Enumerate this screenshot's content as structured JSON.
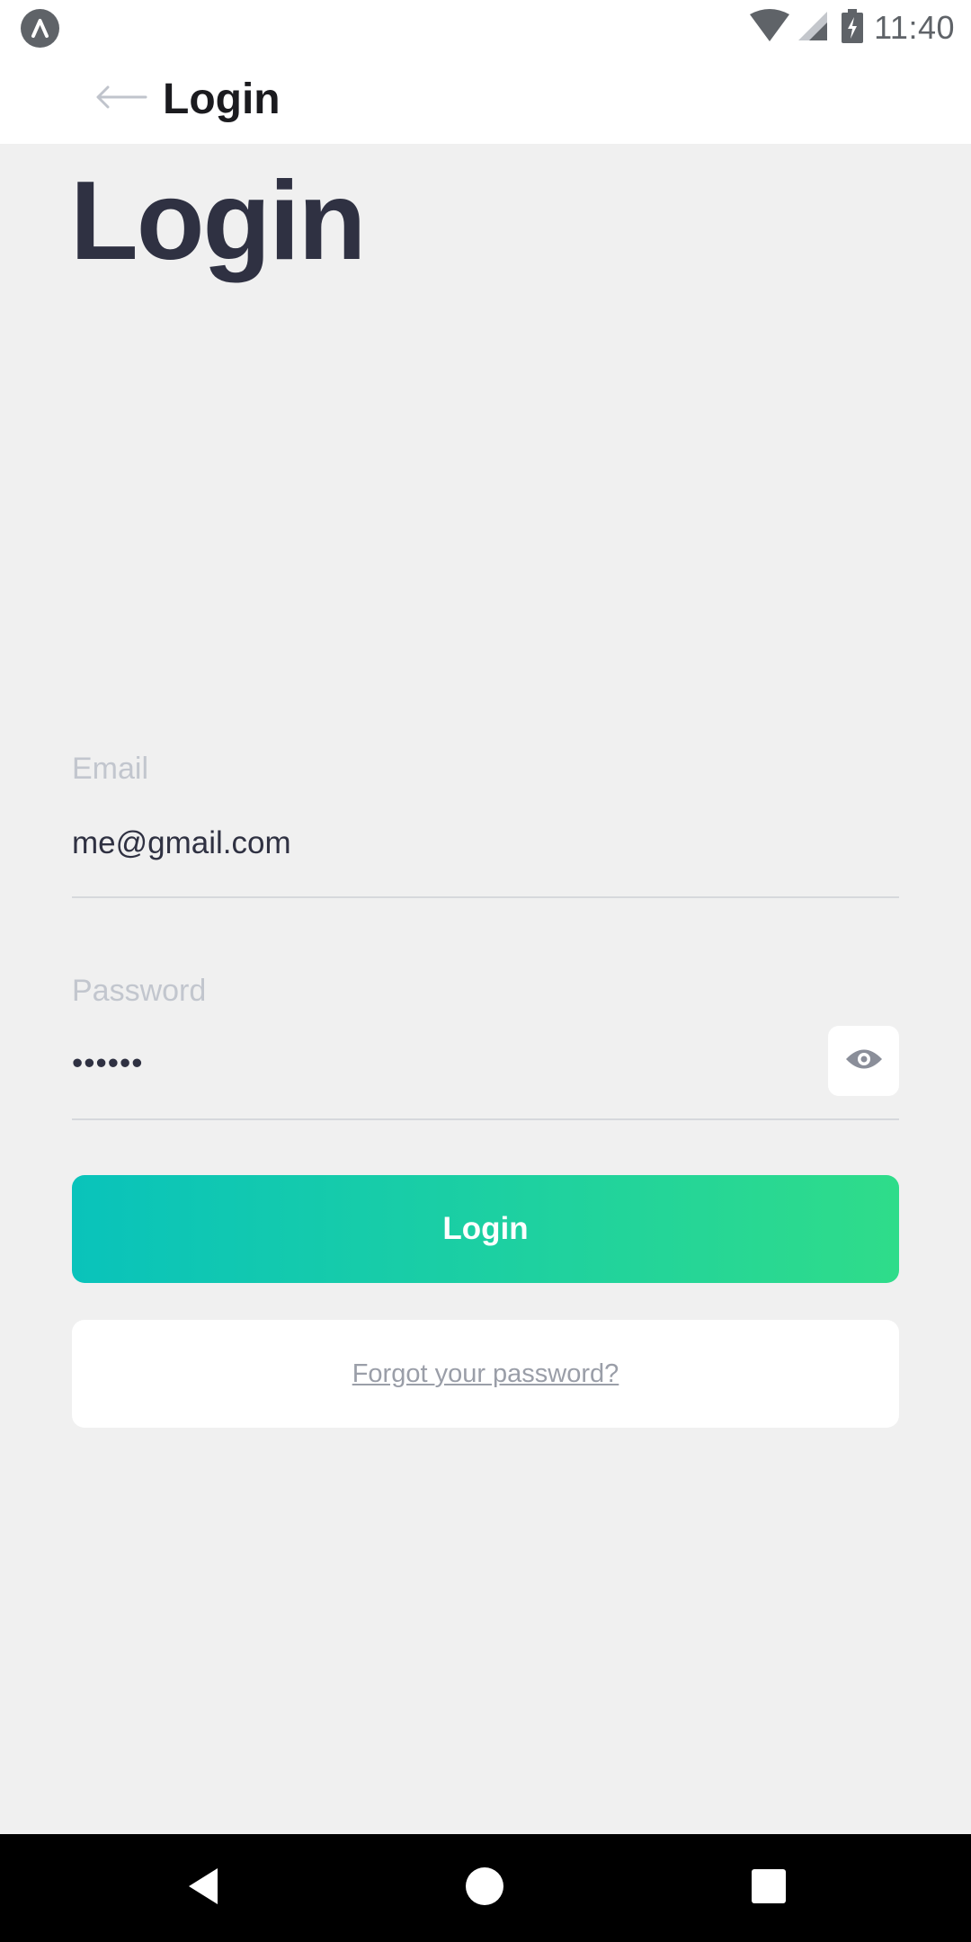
{
  "status_bar": {
    "time": "11:40",
    "icons": [
      "app-notification-icon",
      "wifi-icon",
      "cellular-signal-icon",
      "battery-charging-icon"
    ]
  },
  "app_bar": {
    "back_icon": "arrow-left-icon",
    "title": "Login"
  },
  "page": {
    "heading": "Login"
  },
  "form": {
    "email": {
      "label": "Email",
      "value": "me@gmail.com"
    },
    "password": {
      "label": "Password",
      "value": "••••••",
      "toggle_icon": "eye-icon"
    },
    "login_button_label": "Login",
    "forgot_password_label": "Forgot your password?"
  },
  "colors": {
    "accent_start": "#09c3bb",
    "accent_end": "#2fdc8a",
    "heading": "#2f3142",
    "background": "#f0f0f0"
  },
  "nav_bar": {
    "buttons": [
      "back-triangle-icon",
      "home-circle-icon",
      "recents-square-icon"
    ]
  }
}
